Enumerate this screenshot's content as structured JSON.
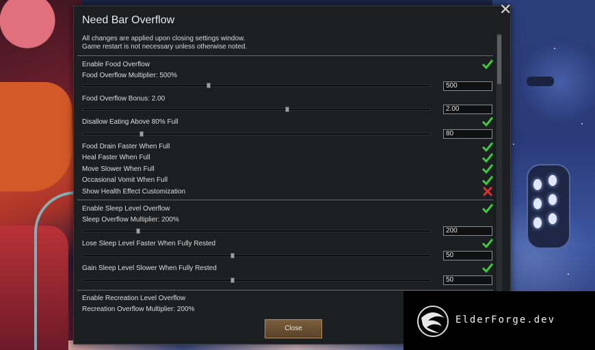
{
  "window": {
    "title": "Need Bar Overflow",
    "notice": [
      "All changes are applied upon closing settings window.",
      "Game restart is not necessary unless otherwise noted."
    ],
    "close_button_label": "Close"
  },
  "colors": {
    "check_green": "#3fca3f",
    "cross_red": "#e03030",
    "button_bg": "#6a4f33"
  },
  "settings": {
    "food": {
      "enable": {
        "label": "Enable Food Overflow",
        "checked": true
      },
      "multiplier": {
        "label": "Food Overflow Multiplier: 500%",
        "value": "500",
        "slider_fraction": 0.36
      },
      "bonus": {
        "label": "Food Overflow Bonus: 2.00",
        "value": "2.00",
        "slider_fraction": 0.59
      },
      "disallow": {
        "label": "Disallow Eating Above 80% Full",
        "checked": true,
        "value": "80",
        "slider_fraction": 0.165
      },
      "drain": {
        "label": "Food Drain Faster When Full",
        "checked": true
      },
      "heal": {
        "label": "Heal Faster When Full",
        "checked": true
      },
      "slower": {
        "label": "Move Slower When Full",
        "checked": true
      },
      "vomit": {
        "label": "Occasional Vomit When Full",
        "checked": true
      },
      "health_custom": {
        "label": "Show Health Effect Customization",
        "checked": false
      }
    },
    "sleep": {
      "enable": {
        "label": "Enable Sleep Level Overflow",
        "checked": true
      },
      "multiplier": {
        "label": "Sleep Overflow Multiplier: 200%",
        "value": "200",
        "slider_fraction": 0.155
      },
      "lose_faster": {
        "label": "Lose Sleep Level Faster When Fully Rested",
        "checked": true,
        "value": "50",
        "slider_fraction": 0.43
      },
      "gain_slower": {
        "label": "Gain Sleep Level Slower When Fully Rested",
        "checked": true,
        "value": "50",
        "slider_fraction": 0.43
      }
    },
    "recreation": {
      "enable": {
        "label": "Enable Recreation Level Overflow"
      },
      "multiplier": {
        "label": "Recreation Overflow Multiplier: 200%"
      }
    }
  },
  "watermark": {
    "text": "ElderForge.dev"
  }
}
